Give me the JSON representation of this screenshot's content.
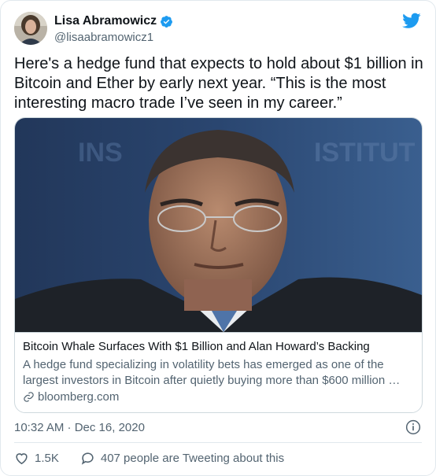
{
  "author": {
    "name": "Lisa Abramowicz",
    "handle": "@lisaabramowicz1"
  },
  "tweet_text": "Here's a hedge fund that expects to hold about $1 billion in Bitcoin and Ether by early next year. “This is the most interesting macro trade I’ve seen in my career.”",
  "card": {
    "title": "Bitcoin Whale Surfaces With $1 Billion and Alan Howard’s Backing",
    "description": "A hedge fund specializing in volatility bets has emerged as one of the largest investors in Bitcoin after quietly buying more than $600 million …",
    "domain": "bloomberg.com"
  },
  "timestamp": "10:32 AM · Dec 16, 2020",
  "actions": {
    "likes": "1.5K",
    "conversation": "407 people are Tweeting about this"
  },
  "colors": {
    "twitter_blue": "#1d9bf0",
    "secondary_text": "#536471",
    "heart_red": "#e0245e"
  },
  "icons": {
    "verified": "verified-badge-icon",
    "logo": "twitter-bird-icon",
    "link": "link-icon",
    "info": "info-icon",
    "like": "heart-icon",
    "reply": "speech-bubble-icon"
  }
}
